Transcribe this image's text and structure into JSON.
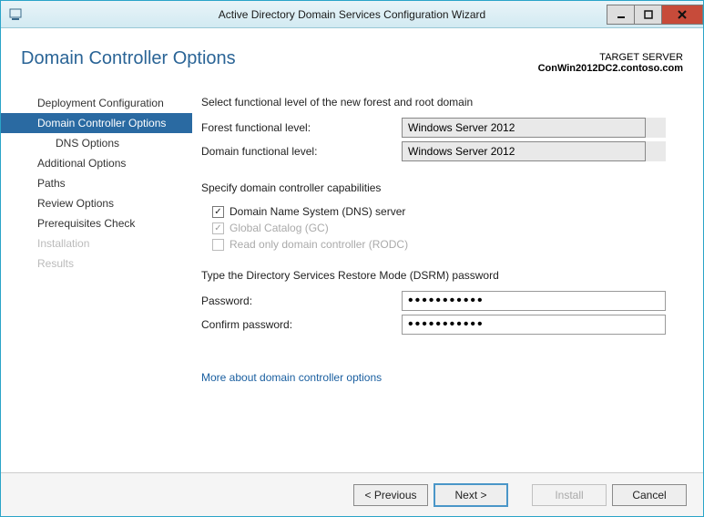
{
  "window": {
    "title": "Active Directory Domain Services Configuration Wizard"
  },
  "header": {
    "page_title": "Domain Controller Options",
    "target_label": "TARGET SERVER",
    "target_server": "ConWin2012DC2.contoso.com"
  },
  "steps": [
    {
      "label": "Deployment Configuration",
      "selected": false,
      "indent": false,
      "disabled": false
    },
    {
      "label": "Domain Controller Options",
      "selected": true,
      "indent": false,
      "disabled": false
    },
    {
      "label": "DNS Options",
      "selected": false,
      "indent": true,
      "disabled": false
    },
    {
      "label": "Additional Options",
      "selected": false,
      "indent": false,
      "disabled": false
    },
    {
      "label": "Paths",
      "selected": false,
      "indent": false,
      "disabled": false
    },
    {
      "label": "Review Options",
      "selected": false,
      "indent": false,
      "disabled": false
    },
    {
      "label": "Prerequisites Check",
      "selected": false,
      "indent": false,
      "disabled": false
    },
    {
      "label": "Installation",
      "selected": false,
      "indent": false,
      "disabled": true
    },
    {
      "label": "Results",
      "selected": false,
      "indent": false,
      "disabled": true
    }
  ],
  "main": {
    "select_level_label": "Select functional level of the new forest and root domain",
    "forest_label": "Forest functional level:",
    "forest_value": "Windows Server 2012",
    "domain_label": "Domain functional level:",
    "domain_value": "Windows Server 2012",
    "capabilities_label": "Specify domain controller capabilities",
    "cap_dns": {
      "label": "Domain Name System (DNS) server",
      "checked": true,
      "enabled": true
    },
    "cap_gc": {
      "label": "Global Catalog (GC)",
      "checked": true,
      "enabled": false
    },
    "cap_rodc": {
      "label": "Read only domain controller (RODC)",
      "checked": false,
      "enabled": false
    },
    "dsrm_label": "Type the Directory Services Restore Mode (DSRM) password",
    "password_label": "Password:",
    "password_value": "•••••••••••",
    "confirm_label": "Confirm password:",
    "confirm_value": "•••••••••••",
    "more_link": "More about domain controller options"
  },
  "footer": {
    "previous": "< Previous",
    "next": "Next >",
    "install": "Install",
    "cancel": "Cancel"
  }
}
